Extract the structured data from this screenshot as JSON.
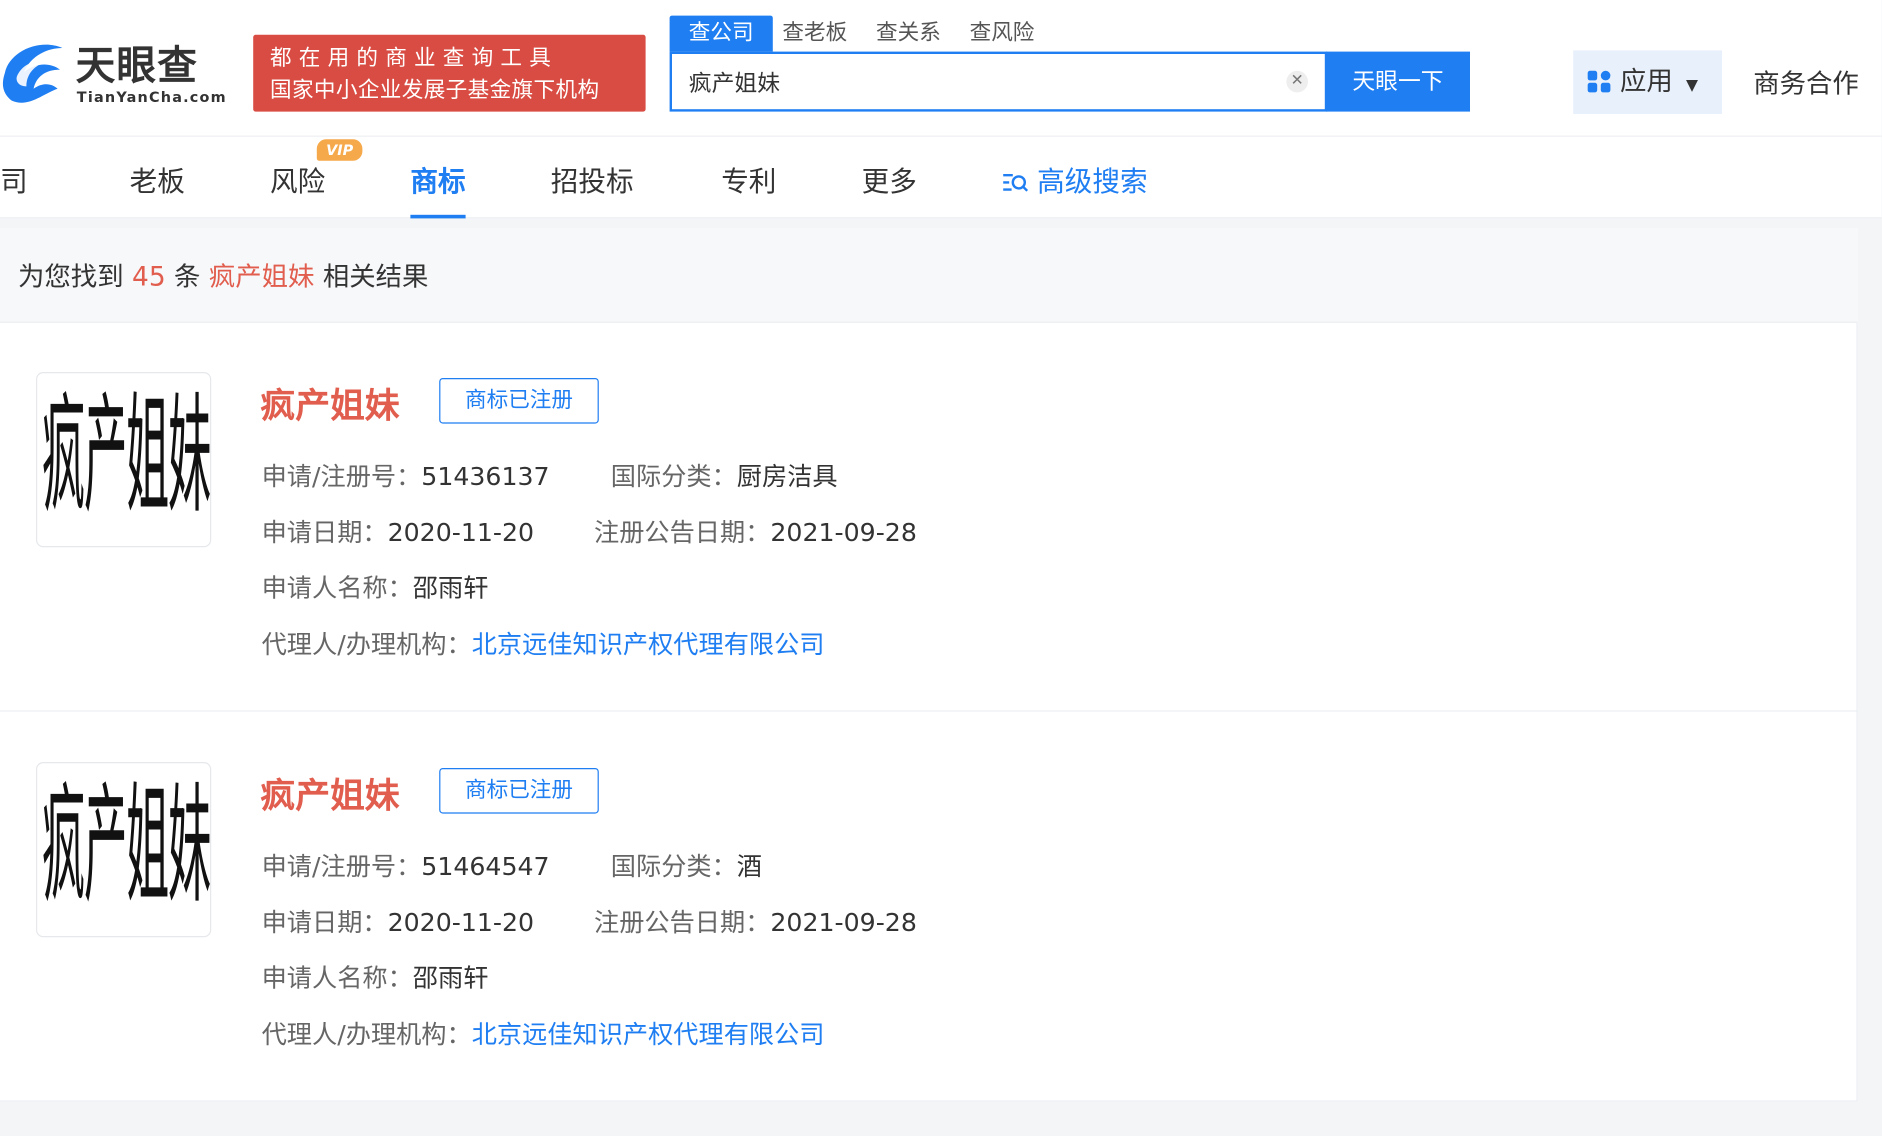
{
  "header": {
    "logo_text": "天眼查",
    "logo_sub": "TianYanCha.com",
    "banner_line1": "都在用的商业查询工具",
    "banner_line2": "国家中小企业发展子基金旗下机构",
    "search_tabs": [
      "查公司",
      "查老板",
      "查关系",
      "查风险"
    ],
    "search_value": "疯产姐妹",
    "search_button": "天眼一下",
    "app_label": "应用",
    "biz_label": "商务合作",
    "colors": {
      "brand_blue": "#1f7ef2",
      "banner_red": "#d94c43",
      "highlight_red": "#e15e4e"
    }
  },
  "nav": {
    "items": [
      "公司",
      "老板",
      "风险",
      "商标",
      "招投标",
      "专利",
      "更多"
    ],
    "active": "商标",
    "vip_badge": "VIP",
    "advanced": "高级搜索"
  },
  "results": {
    "summary_prefix": "为您找到",
    "count": "45",
    "summary_mid": "条",
    "keyword": "疯产姐妹",
    "summary_suffix": "相关结果",
    "items": [
      {
        "thumb_text": "疯产姐妹",
        "title": "疯产姐妹",
        "status": "商标已注册",
        "reg_no_label": "申请/注册号：",
        "reg_no": "51436137",
        "class_label": "国际分类：",
        "class": "厨房洁具",
        "apply_date_label": "申请日期：",
        "apply_date": "2020-11-20",
        "notice_date_label": "注册公告日期：",
        "notice_date": "2021-09-28",
        "applicant_label": "申请人名称：",
        "applicant": "邵雨轩",
        "agent_label": "代理人/办理机构：",
        "agent": "北京远佳知识产权代理有限公司"
      },
      {
        "thumb_text": "疯产姐妹",
        "title": "疯产姐妹",
        "status": "商标已注册",
        "reg_no_label": "申请/注册号：",
        "reg_no": "51464547",
        "class_label": "国际分类：",
        "class": "酒",
        "apply_date_label": "申请日期：",
        "apply_date": "2020-11-20",
        "notice_date_label": "注册公告日期：",
        "notice_date": "2021-09-28",
        "applicant_label": "申请人名称：",
        "applicant": "邵雨轩",
        "agent_label": "代理人/办理机构：",
        "agent": "北京远佳知识产权代理有限公司"
      }
    ]
  }
}
